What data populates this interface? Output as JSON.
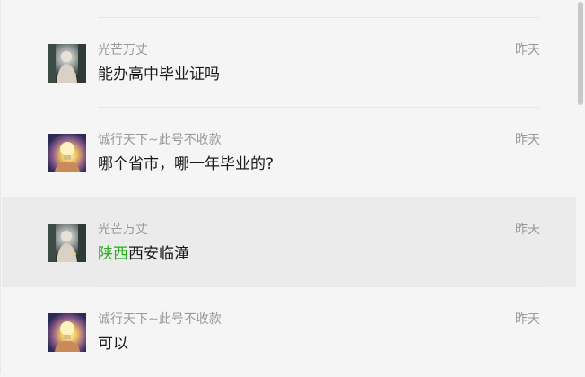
{
  "messages": [
    {
      "sender": "光芒万丈",
      "time": "昨天",
      "text_highlight": "",
      "text": "能办高中毕业证吗",
      "avatar_icon": "dark-portrait-avatar-icon"
    },
    {
      "sender": "诚行天下~此号不收款",
      "time": "昨天",
      "text_highlight": "",
      "text": "哪个省市，哪一年毕业的?",
      "avatar_icon": "lightbulb-hand-avatar-icon"
    },
    {
      "sender": "光芒万丈",
      "time": "昨天",
      "text_highlight": "陕西",
      "text": "西安临潼",
      "avatar_icon": "dark-portrait-avatar-icon"
    },
    {
      "sender": "诚行天下~此号不收款",
      "time": "昨天",
      "text_highlight": "",
      "text": "可以",
      "avatar_icon": "lightbulb-hand-avatar-icon"
    }
  ],
  "colors": {
    "background": "#f5f5f5",
    "highlight_row": "#ebebeb",
    "keyword_green": "#2aae1f",
    "meta_gray": "#999999",
    "text": "#1a1a1a"
  }
}
